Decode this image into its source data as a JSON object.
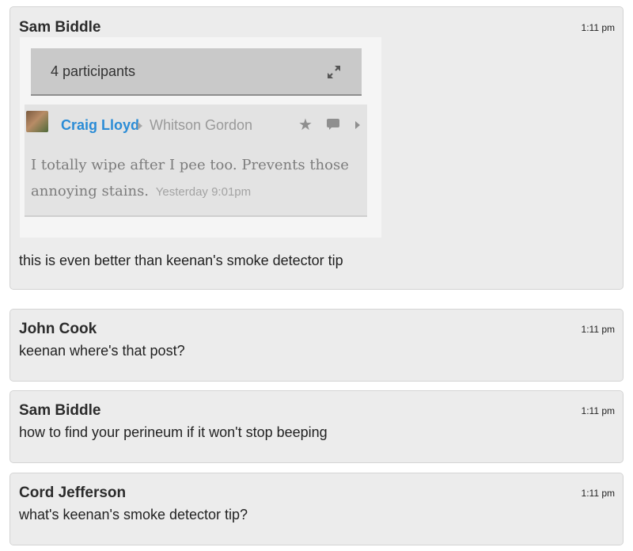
{
  "messages": [
    {
      "author": "Sam Biddle",
      "time": "1:11 pm",
      "text": "this is even better than keenan's smoke detector tip",
      "embed": {
        "participants": "4 participants",
        "comment": {
          "author": "Craig Lloyd",
          "reply_to": "Whitson Gordon",
          "body": "I totally wipe after I pee too. Prevents those annoying stains.",
          "timestamp": "Yesterday 9:01pm"
        }
      }
    },
    {
      "author": "John Cook",
      "time": "1:11 pm",
      "text": "keenan where's that post?"
    },
    {
      "author": "Sam Biddle",
      "time": "1:11 pm",
      "text": "how to find your perineum if it won't stop beeping"
    },
    {
      "author": "Cord Jefferson",
      "time": "1:11 pm",
      "text": "what's keenan's smoke detector tip?"
    }
  ],
  "icons": {
    "expand": "expand-icon",
    "star": "star-icon",
    "comment": "speech-bubble-icon",
    "caret": "caret-right-icon"
  }
}
